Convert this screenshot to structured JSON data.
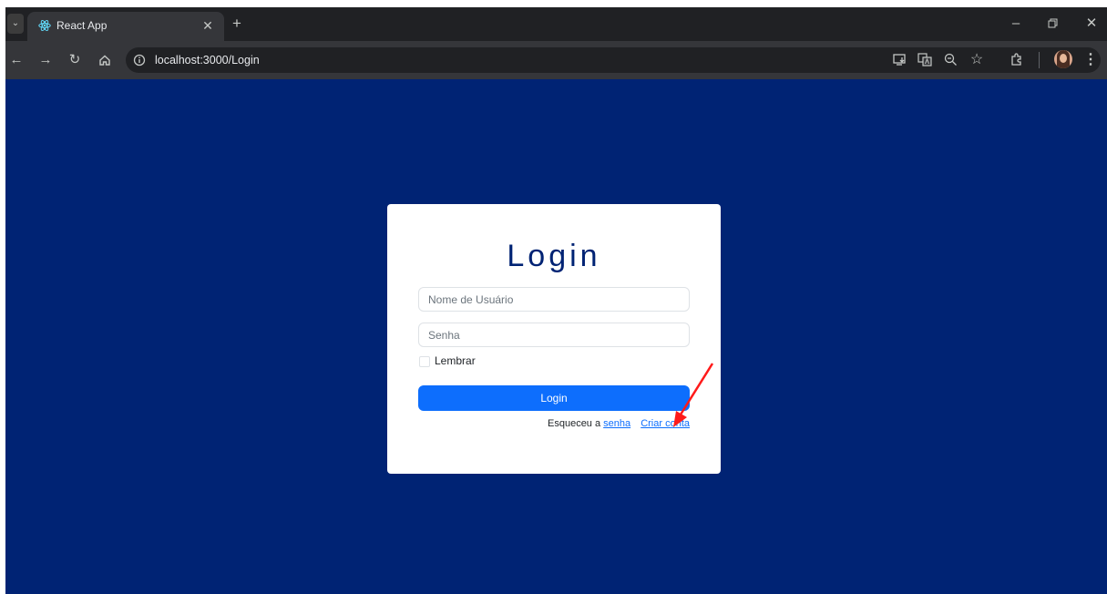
{
  "browser": {
    "tab_title": "React App",
    "url": "localhost:3000/Login"
  },
  "login": {
    "title": "Login",
    "username_placeholder": "Nome de Usuário",
    "password_placeholder": "Senha",
    "remember_label": "Lembrar",
    "submit_label": "Login",
    "forgot_prefix": "Esqueceu a ",
    "forgot_link": "senha",
    "create_account_link": "Criar conta"
  },
  "colors": {
    "background": "#002374",
    "primary": "#0d6efd",
    "annotation_arrow": "#ff1a1a"
  },
  "icons": [
    "tab-list-icon",
    "react-icon",
    "close-icon",
    "new-tab-icon",
    "minimize-icon",
    "restore-icon",
    "back-icon",
    "forward-icon",
    "reload-icon",
    "home-icon",
    "site-info-icon",
    "install-icon",
    "translate-icon",
    "zoom-icon",
    "bookmark-star-icon",
    "extensions-icon",
    "profile-avatar",
    "menu-icon"
  ]
}
